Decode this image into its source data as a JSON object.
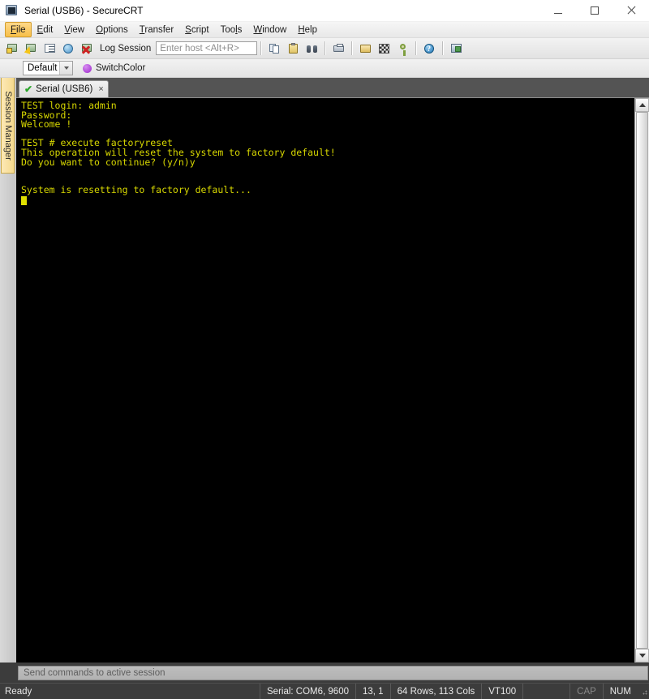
{
  "window": {
    "title": "Serial (USB6) - SecureCRT",
    "icon": "app-terminal-icon",
    "minimize_label": "–",
    "maximize_label": "□",
    "close_label": "×"
  },
  "menubar": {
    "items": [
      {
        "label": "File",
        "mnemonic": "F",
        "active": true
      },
      {
        "label": "Edit",
        "mnemonic": "E",
        "active": false
      },
      {
        "label": "View",
        "mnemonic": "V",
        "active": false
      },
      {
        "label": "Options",
        "mnemonic": "O",
        "active": false
      },
      {
        "label": "Transfer",
        "mnemonic": "T",
        "active": false
      },
      {
        "label": "Script",
        "mnemonic": "S",
        "active": false
      },
      {
        "label": "Tools",
        "mnemonic": "l",
        "active": false
      },
      {
        "label": "Window",
        "mnemonic": "W",
        "active": false
      },
      {
        "label": "Help",
        "mnemonic": "H",
        "active": false
      }
    ]
  },
  "toolbar": {
    "log_session_label": "Log Session",
    "host_placeholder": "Enter host <Alt+R>",
    "host_value": "",
    "icons": [
      "connect-icon",
      "quick-connect-icon",
      "connect-in-tab-icon",
      "connect-sftp-tab-icon",
      "disconnect-icon",
      "copy-icon",
      "paste-icon",
      "find-icon",
      "print-icon",
      "transfer-receive-icon",
      "protocol-icon",
      "key-icon",
      "help-icon",
      "session-options-icon"
    ]
  },
  "session_row": {
    "profile_value": "Default",
    "profile_options": [
      "Default"
    ],
    "color_scheme_label": "SwitchColor",
    "color_scheme_dot": "#9b27c9"
  },
  "side_panel": {
    "tab_label": "Session Manager"
  },
  "tabs": [
    {
      "label": "Serial (USB6)",
      "status_icon": "connected-check-icon",
      "close_label": "×",
      "active": true
    }
  ],
  "terminal": {
    "foreground": "#d8d800",
    "background": "#000000",
    "cursor": "block",
    "lines": [
      "TEST login: admin",
      "Password:",
      "Welcome !",
      "",
      "TEST # execute factoryreset",
      "This operation will reset the system to factory default!",
      "Do you want to continue? (y/n)y",
      "",
      "",
      "System is resetting to factory default..."
    ]
  },
  "scrollbar": {
    "up_arrow": "scroll-up-icon",
    "down_arrow": "scroll-down-icon"
  },
  "command_bar": {
    "placeholder": "Send commands to active session",
    "value": ""
  },
  "statusbar": {
    "ready": "Ready",
    "connection": "Serial: COM6, 9600",
    "cursor_position": "13,   1",
    "dimensions": "64 Rows, 113 Cols",
    "emulation": "VT100",
    "blank": "",
    "caps_lock": "CAP",
    "num_lock": "NUM"
  }
}
